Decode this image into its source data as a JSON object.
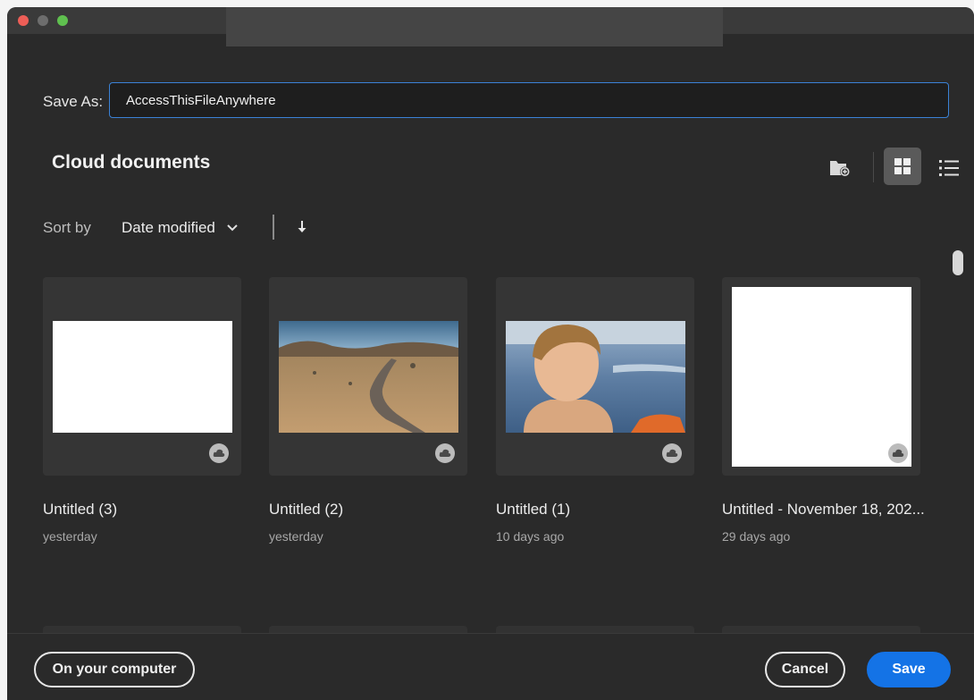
{
  "window": {
    "title": ""
  },
  "save_as": {
    "label": "Save As:",
    "value": "AccessThisFileAnywhere"
  },
  "section": {
    "title": "Cloud documents"
  },
  "toolbar": {
    "icons": [
      "new-folder-icon",
      "grid-view-icon",
      "list-view-icon"
    ],
    "active_view": "grid"
  },
  "sort": {
    "label": "Sort by",
    "selected": "Date modified",
    "direction": "descending"
  },
  "documents": [
    {
      "name": "Untitled (3)",
      "modified": "yesterday",
      "thumbnail": "blank-landscape"
    },
    {
      "name": "Untitled (2)",
      "modified": "yesterday",
      "thumbnail": "desert-road"
    },
    {
      "name": "Untitled (1)",
      "modified": "10 days ago",
      "thumbnail": "boy-on-beach"
    },
    {
      "name": "Untitled - November 18, 202...",
      "modified": "29 days ago",
      "thumbnail": "blank-portrait"
    }
  ],
  "footer": {
    "computer_button": "On your computer",
    "cancel_button": "Cancel",
    "save_button": "Save"
  },
  "colors": {
    "background": "#2a2a2a",
    "accent": "#1473e6",
    "input_border": "#3b82d6"
  }
}
